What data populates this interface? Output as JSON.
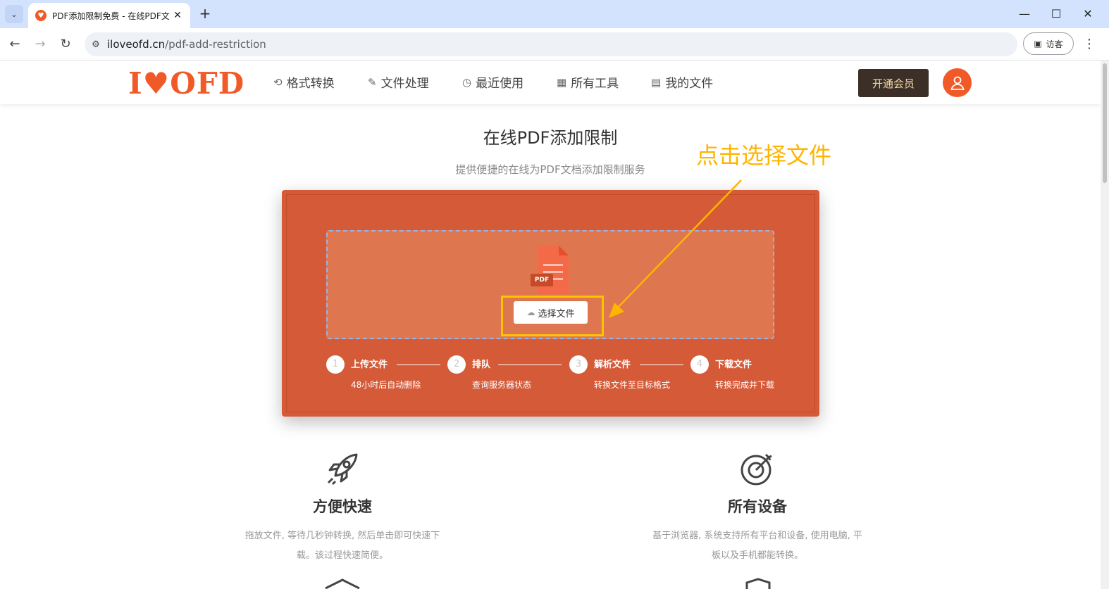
{
  "browser": {
    "tab_title": "PDF添加限制免费 - 在线PDF文",
    "url_host": "iloveofd.cn",
    "url_path": "/pdf-add-restriction",
    "guest_label": "访客"
  },
  "header": {
    "logo": "I♥OFD",
    "menu": [
      "格式转换",
      "文件处理",
      "最近使用",
      "所有工具",
      "我的文件"
    ],
    "vip_button": "开通会员"
  },
  "main": {
    "title": "在线PDF添加限制",
    "subtitle": "提供便捷的在线为PDF文档添加限制服务",
    "annotation": "点击选择文件",
    "file_badge": "PDF",
    "choose_button": "选择文件",
    "steps": [
      {
        "num": "1",
        "title": "上传文件",
        "desc": "48小时后自动删除"
      },
      {
        "num": "2",
        "title": "排队",
        "desc": "查询服务器状态"
      },
      {
        "num": "3",
        "title": "解析文件",
        "desc": "转换文件至目标格式"
      },
      {
        "num": "4",
        "title": "下载文件",
        "desc": "转换完成并下载"
      }
    ]
  },
  "features": [
    {
      "title": "方便快速",
      "line1": "拖放文件, 等待几秒钟转换, 然后单击即可快速下",
      "line2": "载。该过程快速简便。"
    },
    {
      "title": "所有设备",
      "line1": "基于浏览器, 系统支持所有平台和设备, 使用电脑, 平",
      "line2": "板以及手机都能转换。"
    }
  ],
  "colors": {
    "brand": "#f05a28",
    "panel": "#d55a38",
    "annotation": "#ffb400"
  }
}
